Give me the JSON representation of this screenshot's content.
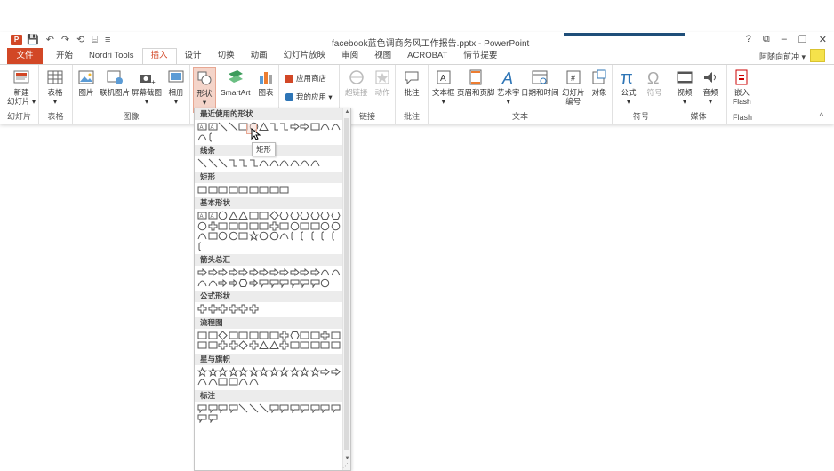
{
  "window": {
    "title": "facebook蓝色调商务风工作报告.pptx - PowerPoint",
    "app_logo": "P",
    "qat": [
      "💾",
      "↶",
      "↷",
      "⟲",
      "⌸",
      "≡"
    ],
    "controls": [
      "?",
      "⧉",
      "–",
      "❐",
      "✕"
    ],
    "accent": "#d24726"
  },
  "tabs": [
    {
      "label": "文件"
    },
    {
      "label": "开始"
    },
    {
      "label": "Nordri Tools"
    },
    {
      "label": "插入"
    },
    {
      "label": "设计"
    },
    {
      "label": "切换"
    },
    {
      "label": "动画"
    },
    {
      "label": "幻灯片放映"
    },
    {
      "label": "审阅"
    },
    {
      "label": "视图"
    },
    {
      "label": "ACROBAT"
    },
    {
      "label": "情节提要"
    }
  ],
  "active_tab": "插入",
  "user": {
    "name": "阿随向前冲 ▾"
  },
  "ribbon": {
    "groups": {
      "slides": "幻灯片",
      "tables": "表格",
      "images": "图像",
      "links": "链接",
      "comments": "批注",
      "text": "文本",
      "symbols": "符号",
      "media": "媒体",
      "flash": "Flash"
    },
    "buttons": {
      "new_slide": "新建\n幻灯片 ▾",
      "table": "表格\n▾",
      "picture": "图片",
      "online_picture": "联机图片",
      "screenshot": "屏幕截图\n▾",
      "album": "相册\n▾",
      "shapes": "形状\n▾",
      "smartart": "SmartArt",
      "chart": "图表",
      "store": "应用商店",
      "my_apps": "我的应用 ▾",
      "hyperlink": "超链接",
      "action": "动作",
      "comment": "批注",
      "textbox": "文本框\n▾",
      "header_footer": "页眉和页脚",
      "wordart": "艺术字\n▾",
      "datetime": "日期和时间",
      "slide_number": "幻灯片\n编号",
      "object": "对象",
      "equation": "公式\n▾",
      "symbol": "符号",
      "video": "视频\n▾",
      "audio": "音频\n▾",
      "embed_flash": "嵌入\nFlash"
    },
    "collapse_icon": "^"
  },
  "shapes_menu": {
    "sections": [
      {
        "title": "最近使用的形状",
        "shapes": [
          "textbox",
          "textbox-v",
          "line",
          "arrow-line",
          "rect",
          "oval",
          "triangle",
          "elbow",
          "elbow-arrow",
          "right-arrow",
          "down-arrow",
          "flowchart-doc",
          "curved-conn",
          "arc",
          "curve",
          "brace"
        ]
      },
      {
        "title": "线条",
        "shapes": [
          "line",
          "arrow-line",
          "dbl-arrow",
          "elbow",
          "elbow-arrow",
          "elbow-dbl",
          "curved",
          "curved-arrow",
          "curved-dbl",
          "curve",
          "freeform",
          "scribble"
        ]
      },
      {
        "title": "矩形",
        "shapes": [
          "rect",
          "round-rect",
          "snip1",
          "snip2",
          "snip-d",
          "snip-round",
          "round1",
          "round2",
          "round-d"
        ]
      },
      {
        "title": "基本形状",
        "shapes": [
          "textbox",
          "textbox-v",
          "oval",
          "triangle",
          "rtriangle",
          "parallelogram",
          "trapezoid",
          "diamond",
          "pentagon",
          "hexagon",
          "heptagon",
          "octagon",
          "decagon",
          "dodecagon",
          "pie",
          "chord",
          "teardrop",
          "frame",
          "halfframe",
          "lshape",
          "diag-stripe",
          "cross",
          "plaque",
          "can",
          "cube",
          "bevel",
          "donut",
          "noentry",
          "blockarc",
          "folded",
          "smiley",
          "heart",
          "lightning",
          "sun",
          "moon",
          "cloud",
          "arc",
          "bracket-pair",
          "brace-pair",
          "lbracket",
          "rbracket",
          "lbrace",
          "rbrace"
        ]
      },
      {
        "title": "箭头总汇",
        "shapes": [
          "right",
          "left",
          "up",
          "down",
          "leftright",
          "updown",
          "quad",
          "leftrightup",
          "bent",
          "uturn",
          "leftup",
          "bentup",
          "curved-right",
          "curved-left",
          "curved-up",
          "curved-down",
          "striped",
          "notched",
          "pentagon-arrow",
          "chevron",
          "right-callout",
          "down-callout",
          "left-callout",
          "up-callout",
          "lr-callout",
          "quad-callout",
          "circular"
        ]
      },
      {
        "title": "公式形状",
        "shapes": [
          "plus",
          "minus",
          "multiply",
          "divide",
          "equal",
          "notequal"
        ]
      },
      {
        "title": "流程图",
        "shapes": [
          "process",
          "alt-process",
          "decision",
          "data",
          "predefined",
          "internal",
          "document",
          "multidoc",
          "terminator",
          "preparation",
          "manual-input",
          "manual-op",
          "connector",
          "offpage",
          "card",
          "punched-tape",
          "summing",
          "or",
          "collate",
          "sort",
          "extract",
          "merge",
          "stored-data",
          "delay",
          "seq-access",
          "magnetic-disk",
          "direct-access",
          "display"
        ]
      },
      {
        "title": "星与旗帜",
        "shapes": [
          "explosion1",
          "explosion2",
          "star4",
          "star5",
          "star6",
          "star7",
          "star8",
          "star10",
          "star12",
          "star16",
          "star24",
          "star32",
          "ribbon-up",
          "ribbon-down",
          "curved-ribbon-up",
          "curved-ribbon-down",
          "vscroll",
          "hscroll",
          "wave",
          "dbl-wave"
        ]
      },
      {
        "title": "标注",
        "shapes": [
          "rect-callout",
          "round-callout",
          "oval-callout",
          "cloud-callout",
          "line1",
          "line2",
          "line3",
          "accent1",
          "accent2",
          "accent3",
          "border1",
          "border2",
          "border3",
          "accent-border1",
          "accent-border2",
          "accent-border3"
        ]
      }
    ],
    "tooltip": "矩形",
    "scroll_up": "▲",
    "scroll_down": "▼",
    "grip": "⋰"
  }
}
